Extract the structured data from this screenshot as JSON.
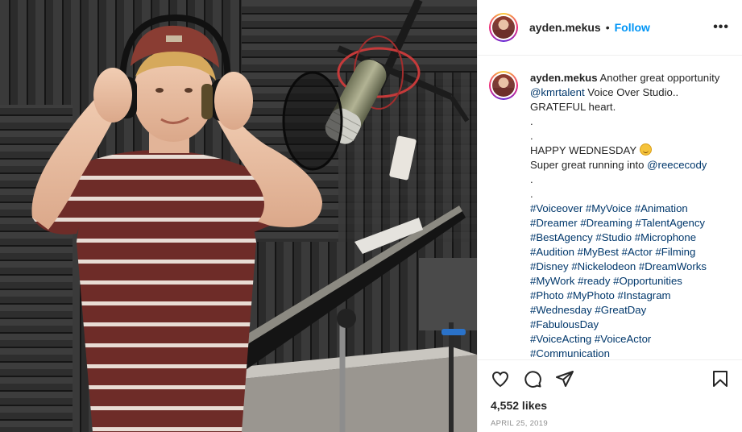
{
  "post": {
    "username": "ayden.mekus",
    "separator": "•",
    "follow_label": "Follow",
    "more_label": "•••",
    "photo_alt": "recording studio photo"
  },
  "caption": {
    "username": "ayden.mekus",
    "lines": [
      {
        "type": "mixed",
        "parts": [
          {
            "text": " Another great opportunity ",
            "kind": "text"
          },
          {
            "text": "@kmrtalent",
            "kind": "mention"
          },
          {
            "text": " Voice Over Studio.. GRATEFUL heart.",
            "kind": "text"
          }
        ]
      },
      {
        "type": "plain",
        "text": "."
      },
      {
        "type": "plain",
        "text": "."
      },
      {
        "type": "emoji",
        "text": "HAPPY WEDNESDAY ",
        "emoji": "smiling-face-emoji"
      },
      {
        "type": "mixed",
        "parts": [
          {
            "text": "Super great running into ",
            "kind": "text"
          },
          {
            "text": "@reececody",
            "kind": "mention"
          }
        ]
      },
      {
        "type": "plain",
        "text": "."
      },
      {
        "type": "plain",
        "text": "."
      }
    ],
    "hashtag_lines": [
      [
        "#Voiceover",
        "#MyVoice",
        "#Animation"
      ],
      [
        "#Dreamer",
        "#Dreaming",
        "#TalentAgency"
      ],
      [
        "#BestAgency",
        "#Studio",
        "#Microphone"
      ],
      [
        "#Audition",
        "#MyBest",
        "#Actor",
        "#Filming"
      ],
      [
        "#Disney",
        "#Nickelodeon",
        "#DreamWorks"
      ],
      [
        "#MyWork",
        "#ready",
        "#Opportunities"
      ],
      [
        "#Photo",
        "#MyPhoto",
        "#Instagram"
      ],
      [
        "#Wednesday",
        "#GreatDay"
      ],
      [
        "#FabulousDay"
      ],
      [
        "#VoiceActing",
        "#VoiceActor"
      ],
      [
        "#Communication"
      ]
    ]
  },
  "actions": {
    "icons": [
      "heart-icon",
      "comment-icon",
      "share-icon",
      "bookmark-icon"
    ],
    "likes_text": "4,552 likes",
    "date_text": "APRIL 25, 2019"
  },
  "colors": {
    "link": "#00376b",
    "follow": "#0095f6",
    "text": "#262626",
    "muted": "#8e8e8e"
  }
}
